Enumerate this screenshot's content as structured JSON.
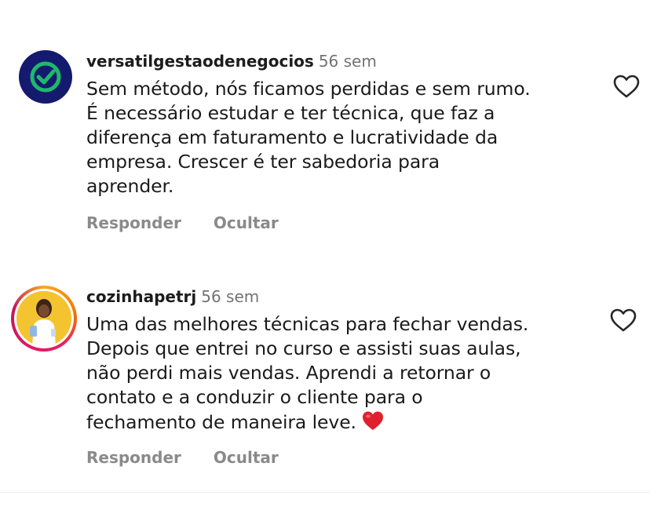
{
  "comments": [
    {
      "username": "versatilgestaodenegocios",
      "time": "56 sem",
      "lines": [
        "Sem método, nós ficamos perdidas e sem rumo.",
        "É necessário estudar e ter técnica, que faz a",
        "diferença em faturamento e lucratividade da",
        "empresa. Crescer é ter sabedoria para",
        "aprender."
      ],
      "reply_label": "Responder",
      "hide_label": "Ocultar",
      "avatar_color": "#141a6e",
      "avatar_check_color": "#1fb86b"
    },
    {
      "username": "cozinhapetrj",
      "time": "56 sem",
      "lines": [
        "Uma das melhores técnicas para fechar vendas.",
        "Depois que entrei no curso e assisti suas aulas,",
        "não perdi mais vendas. Aprendi a retornar o",
        "contato e a conduzir o cliente para o",
        "fechamento de maneira leve."
      ],
      "emoji": "red-heart-emoji",
      "reply_label": "Responder",
      "hide_label": "Ocultar",
      "avatar_color": "#f4c430"
    }
  ],
  "icons": {
    "like": "heart-outline-icon"
  },
  "colors": {
    "text": "#1a1a1a",
    "muted": "#737373",
    "action": "#8a8a8a",
    "emoji_heart": "#e0202e"
  }
}
